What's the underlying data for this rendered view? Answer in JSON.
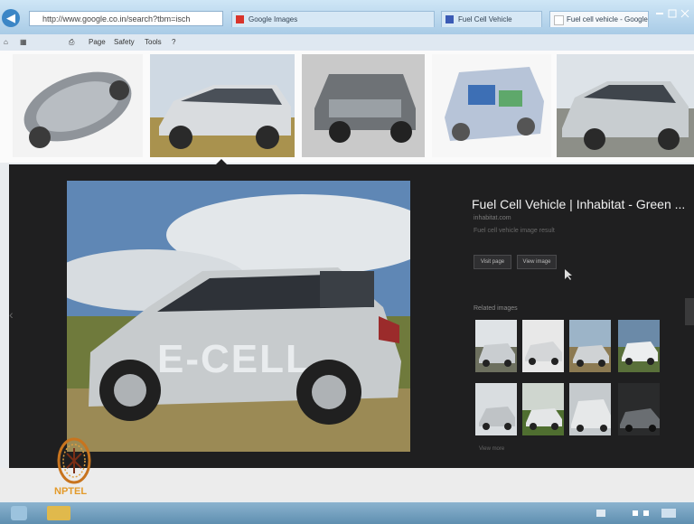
{
  "browser": {
    "back_icon": "back-arrow-icon",
    "address": "http://www.google.co.in/search?tbm=isch",
    "tabs": [
      {
        "label": "Google Images"
      },
      {
        "label": "Fuel Cell Vehicle"
      },
      {
        "label": "Fuel cell vehicle - Google Search"
      }
    ],
    "menu": [
      "Page",
      "Safety",
      "Tools"
    ]
  },
  "viewer": {
    "title": "Fuel Cell Vehicle | Inhabitat - Green ...",
    "source": "inhabitat.com",
    "description": "Fuel cell vehicle image result",
    "buttons": [
      "Visit page",
      "View image"
    ],
    "related_label": "Related images",
    "more_related": "View more"
  },
  "overlay": {
    "logo_text": "NPTEL"
  },
  "colors": {
    "viewer_bg": "#1f1f20",
    "chrome": "#a9cbe6",
    "accent": "#3b86c6"
  }
}
